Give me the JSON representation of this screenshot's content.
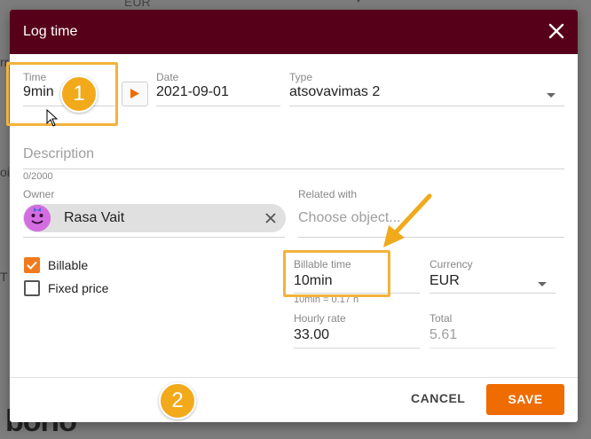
{
  "background": {
    "eur": "EUR",
    "letters": [
      "rr",
      "oi",
      "T"
    ],
    "logo": "borio"
  },
  "dialog": {
    "title": "Log time",
    "close_icon": "close-icon",
    "header_color": "#56001a"
  },
  "fields": {
    "time": {
      "label": "Time",
      "value": "9min"
    },
    "date": {
      "label": "Date",
      "value": "2021-09-01"
    },
    "type": {
      "label": "Type",
      "value": "atsovavimas 2"
    },
    "description": {
      "placeholder": "Description",
      "counter": "0/2000"
    },
    "owner": {
      "label": "Owner",
      "value": "Rasa Vait"
    },
    "related": {
      "label": "Related with",
      "placeholder": "Choose object..."
    },
    "billable_time": {
      "label": "Billable time",
      "value": "10min",
      "hint": "10min = 0.17 h"
    },
    "currency": {
      "label": "Currency",
      "value": "EUR"
    },
    "hourly_rate": {
      "label": "Hourly rate",
      "value": "33.00"
    },
    "total": {
      "label": "Total",
      "value": "5.61"
    }
  },
  "checkboxes": {
    "billable": {
      "label": "Billable",
      "checked": true
    },
    "fixed_price": {
      "label": "Fixed price",
      "checked": false
    }
  },
  "actions": {
    "cancel": "CANCEL",
    "save": "SAVE",
    "accent": "#ef6c00"
  },
  "annotations": {
    "badge_1": "1",
    "badge_2": "2",
    "highlight_color": "#f2b33c"
  }
}
